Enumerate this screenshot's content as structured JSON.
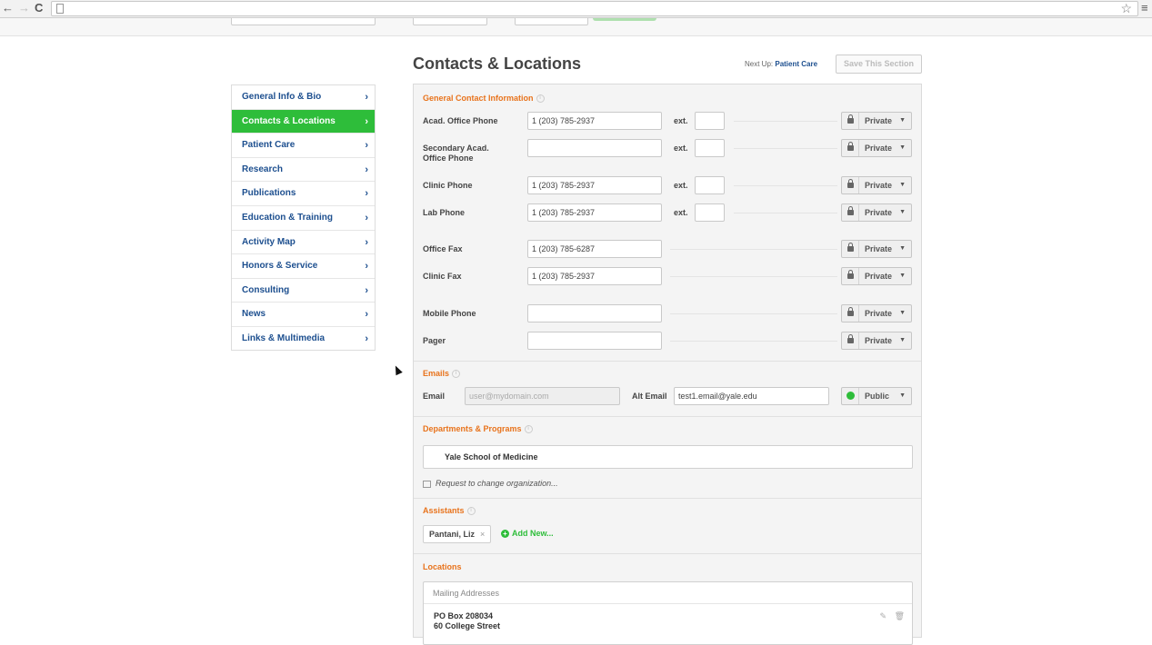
{
  "browser": {
    "back": "←",
    "forward": "→",
    "reload": "C",
    "star": "☆",
    "menu": "≡"
  },
  "nav": {
    "items": [
      {
        "label": "General Info & Bio",
        "active": false
      },
      {
        "label": "Contacts & Locations",
        "active": true
      },
      {
        "label": "Patient Care",
        "active": false
      },
      {
        "label": "Research",
        "active": false
      },
      {
        "label": "Publications",
        "active": false
      },
      {
        "label": "Education & Training",
        "active": false
      },
      {
        "label": "Activity Map",
        "active": false
      },
      {
        "label": "Honors & Service",
        "active": false
      },
      {
        "label": "Consulting",
        "active": false
      },
      {
        "label": "News",
        "active": false
      },
      {
        "label": "Links & Multimedia",
        "active": false
      }
    ],
    "chevron": "›"
  },
  "header": {
    "title": "Contacts & Locations",
    "next_up_prefix": "Next Up:",
    "next_up_link": "Patient Care",
    "save_label": "Save This Section"
  },
  "contact": {
    "title": "General Contact Information",
    "ext_label": "ext.",
    "rows": [
      {
        "label": "Acad. Office Phone",
        "value": "1 (203) 785-2937",
        "privacy": "Private"
      },
      {
        "label": "Secondary Acad. Office Phone",
        "value": "",
        "privacy": "Private"
      },
      {
        "label": "Clinic Phone",
        "value": "1 (203) 785-2937",
        "privacy": "Private"
      },
      {
        "label": "Lab Phone",
        "value": "1 (203) 785-2937",
        "privacy": "Private"
      },
      {
        "label": "Office Fax",
        "value": "1 (203) 785-6287",
        "privacy": "Private"
      },
      {
        "label": "Clinic Fax",
        "value": "1 (203) 785-2937",
        "privacy": "Private"
      },
      {
        "label": "Mobile Phone",
        "value": "",
        "privacy": "Private"
      },
      {
        "label": "Pager",
        "value": "",
        "privacy": "Private"
      }
    ]
  },
  "emails": {
    "title": "Emails",
    "email_label": "Email",
    "email_placeholder": "user@mydomain.com",
    "alt_label": "Alt Email",
    "alt_value": "test1.email@yale.edu",
    "privacy": "Public"
  },
  "departments": {
    "title": "Departments & Programs",
    "org": "Yale School of Medicine",
    "request_link": "Request to change organization..."
  },
  "assistants": {
    "title": "Assistants",
    "tag": "Pantani, Liz",
    "remove": "×",
    "add_new": "Add New..."
  },
  "locations": {
    "title": "Locations",
    "mailing_header": "Mailing Addresses",
    "address_line1": "PO Box 208034",
    "address_line2": "60 College Street"
  }
}
